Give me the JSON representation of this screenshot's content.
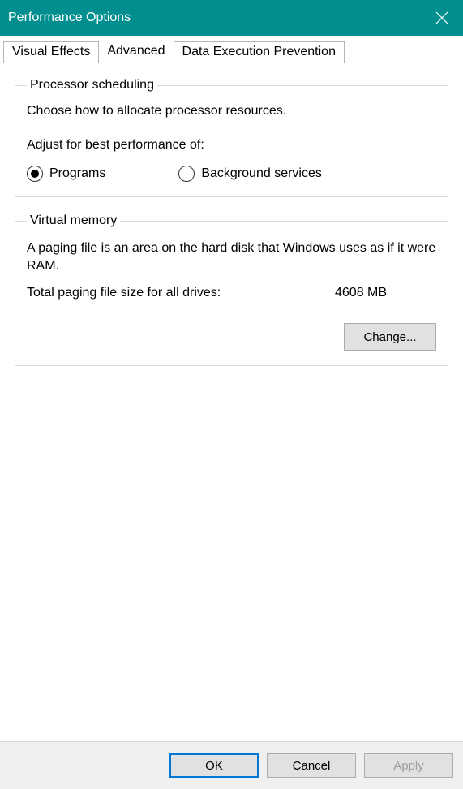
{
  "window": {
    "title": "Performance Options"
  },
  "tabs": {
    "visual_effects": "Visual Effects",
    "advanced": "Advanced",
    "dep": "Data Execution Prevention"
  },
  "processor_scheduling": {
    "legend": "Processor scheduling",
    "description": "Choose how to allocate processor resources.",
    "adjust_label": "Adjust for best performance of:",
    "programs": "Programs",
    "background": "Background services"
  },
  "virtual_memory": {
    "legend": "Virtual memory",
    "description": "A paging file is an area on the hard disk that Windows uses as if it were RAM.",
    "total_label": "Total paging file size for all drives:",
    "total_value": "4608 MB",
    "change_button": "Change..."
  },
  "footer": {
    "ok": "OK",
    "cancel": "Cancel",
    "apply": "Apply"
  }
}
